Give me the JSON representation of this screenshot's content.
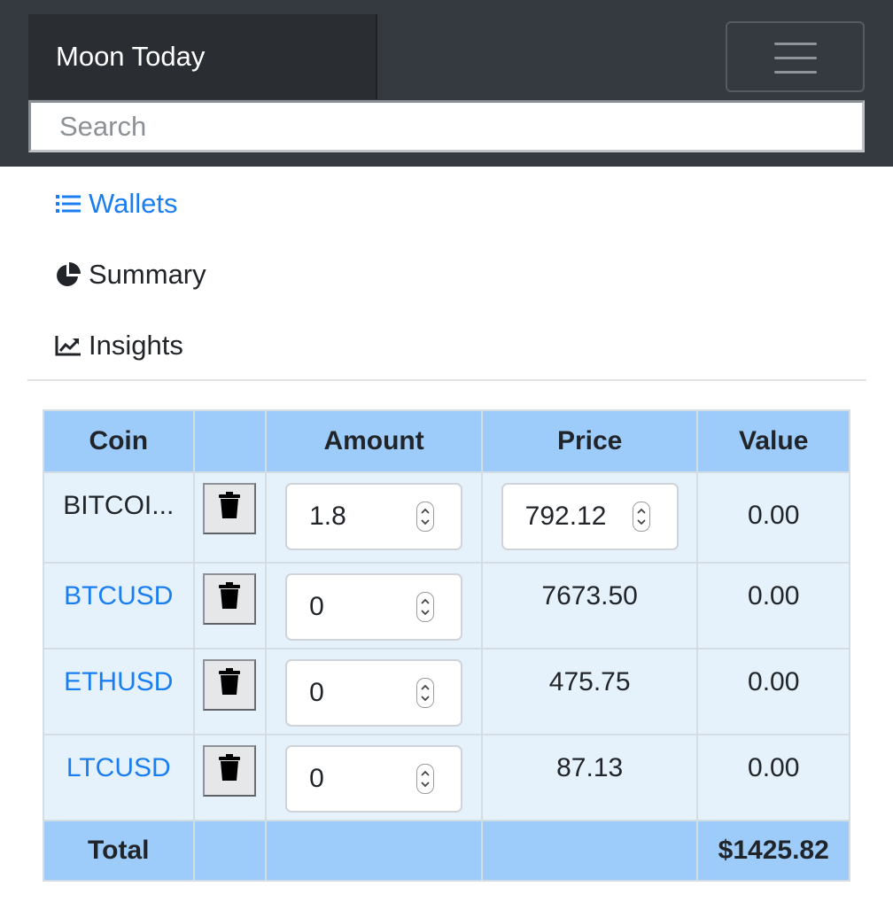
{
  "navbar": {
    "brand": "Moon Today",
    "search_placeholder": "Search",
    "menu_icon": "hamburger-menu-icon"
  },
  "sidenav": {
    "items": [
      {
        "label": "Wallets",
        "icon": "list-icon",
        "active": true
      },
      {
        "label": "Summary",
        "icon": "pie-chart-icon",
        "active": false
      },
      {
        "label": "Insights",
        "icon": "line-chart-icon",
        "active": false
      }
    ]
  },
  "table": {
    "headers": {
      "coin": "Coin",
      "actions": "",
      "amount": "Amount",
      "price": "Price",
      "value": "Value"
    },
    "rows": [
      {
        "coin": "BITCOI...",
        "coin_link": false,
        "amount": "1.8",
        "price": "792.12",
        "price_editable": true,
        "value": "0.00"
      },
      {
        "coin": "BTCUSD",
        "coin_link": true,
        "amount": "0",
        "price": "7673.50",
        "price_editable": false,
        "value": "0.00"
      },
      {
        "coin": "ETHUSD",
        "coin_link": true,
        "amount": "0",
        "price": "475.75",
        "price_editable": false,
        "value": "0.00"
      },
      {
        "coin": "LTCUSD",
        "coin_link": true,
        "amount": "0",
        "price": "87.13",
        "price_editable": false,
        "value": "0.00"
      }
    ],
    "footer": {
      "label": "Total",
      "total": "$1425.82"
    }
  },
  "colors": {
    "navbar_bg": "#343a40",
    "brand_bg": "#2a2e33",
    "accent": "#1a7ef0",
    "header_bg": "#9dccfa",
    "row_bg": "#e5f2fc"
  }
}
